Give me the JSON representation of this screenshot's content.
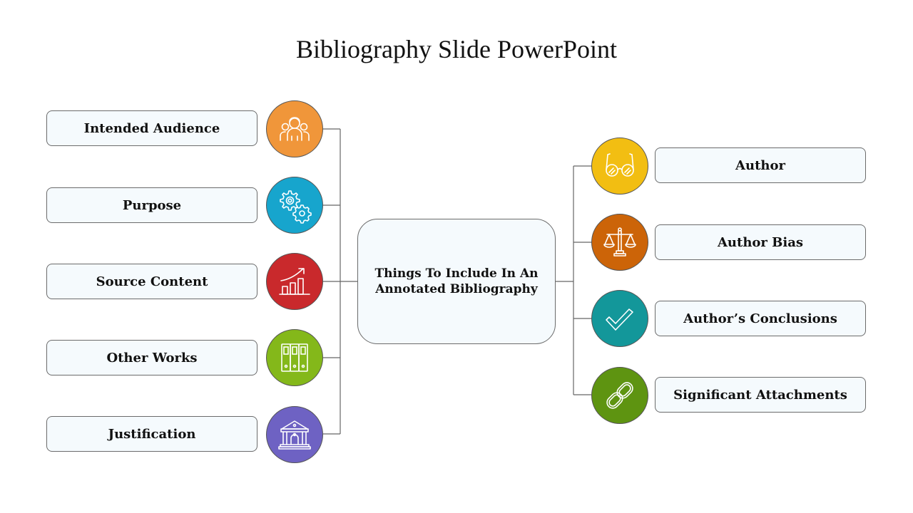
{
  "slide": {
    "title": "Bibliography Slide PowerPoint",
    "center": {
      "text": "Things To Include In An Annotated Bibliography"
    },
    "left_items": [
      {
        "label": "Intended Audience",
        "icon": "people-group-icon",
        "color": "#f0963a"
      },
      {
        "label": "Purpose",
        "icon": "gears-icon",
        "color": "#17a5cd"
      },
      {
        "label": "Source Content",
        "icon": "growth-chart-icon",
        "color": "#c9292c"
      },
      {
        "label": "Other Works",
        "icon": "binders-icon",
        "color": "#84b81a"
      },
      {
        "label": "Justification",
        "icon": "institution-building-icon",
        "color": "#6e62c3"
      }
    ],
    "right_items": [
      {
        "label": "Author",
        "icon": "glasses-icon",
        "color": "#f2be12"
      },
      {
        "label": "Author Bias",
        "icon": "scales-icon",
        "color": "#cc6408"
      },
      {
        "label": "Author’s Conclusions",
        "icon": "checkmark-icon",
        "color": "#13979a"
      },
      {
        "label": "Significant Attachments",
        "icon": "chain-link-icon",
        "color": "#5e9411"
      }
    ]
  }
}
